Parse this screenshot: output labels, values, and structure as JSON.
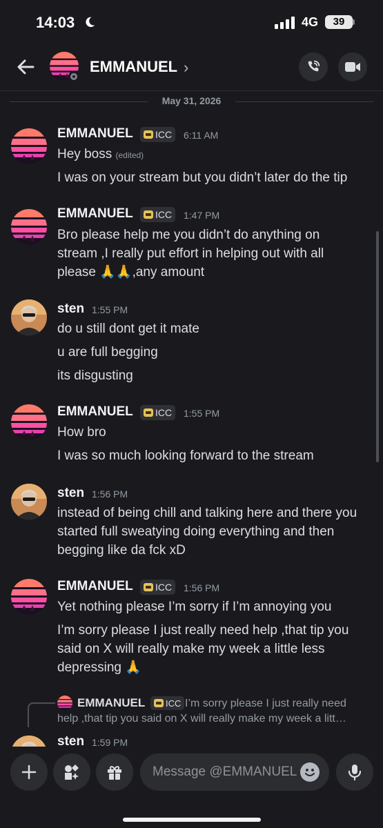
{
  "status_bar": {
    "time": "14:03",
    "network": "4G",
    "battery": "39"
  },
  "header": {
    "name": "EMMANUEL",
    "chevron": "›"
  },
  "date_divider": "May 31, 2026",
  "tag_label": "ICC",
  "messages": [
    {
      "author": "EMMANUEL",
      "time": "6:11 AM",
      "lines": [
        "Hey boss",
        "I was on your stream but you didn’t later do the tip"
      ],
      "edited": "(edited)"
    },
    {
      "author": "EMMANUEL",
      "time": "1:47 PM",
      "lines": [
        "Bro please help me you didn’t do anything on",
        "stream ,I really put effort in helping out with all",
        "please 🙏🙏,any amount"
      ]
    },
    {
      "author": "sten",
      "time": "1:55 PM",
      "lines": [
        "do u still dont get it mate",
        "u are full begging",
        "its disgusting"
      ]
    },
    {
      "author": "EMMANUEL",
      "time": "1:55 PM",
      "lines": [
        "How bro",
        "I was so much looking forward to the stream"
      ]
    },
    {
      "author": "sten",
      "time": "1:56 PM",
      "lines": [
        "instead of being chill and talking here and there you",
        "started full sweatying doing everything and then",
        "begging like da fck xD"
      ]
    },
    {
      "author": "EMMANUEL",
      "time": "1:56 PM",
      "lines": [
        "Yet nothing please I’m sorry if I’m annoying you",
        "I’m sorry please I just really need help ,that tip you",
        "said on X will really make my week a little less",
        "depressing 🙏"
      ]
    },
    {
      "author": "sten",
      "time": "1:59 PM",
      "lines": []
    }
  ],
  "reply": {
    "author": "EMMANUEL",
    "text_line1": "I’m sorry please I just really need",
    "text_line2": "help ,that tip you said on X will really make my week a litt…"
  },
  "composer": {
    "placeholder": "Message @EMMANUEL"
  },
  "icons": {
    "back": "back-arrow-icon",
    "call": "phone-call-icon",
    "video": "video-camera-icon",
    "plus": "plus-icon",
    "apps": "apps-icon",
    "gift": "gift-icon",
    "emoji": "emoji-icon",
    "mic": "microphone-icon"
  },
  "colors": {
    "background": "#1a1a1e",
    "surface": "#2b2d31",
    "text": "#dbdee1",
    "muted": "#949ba4",
    "tag_icon": "#e6c25c"
  }
}
